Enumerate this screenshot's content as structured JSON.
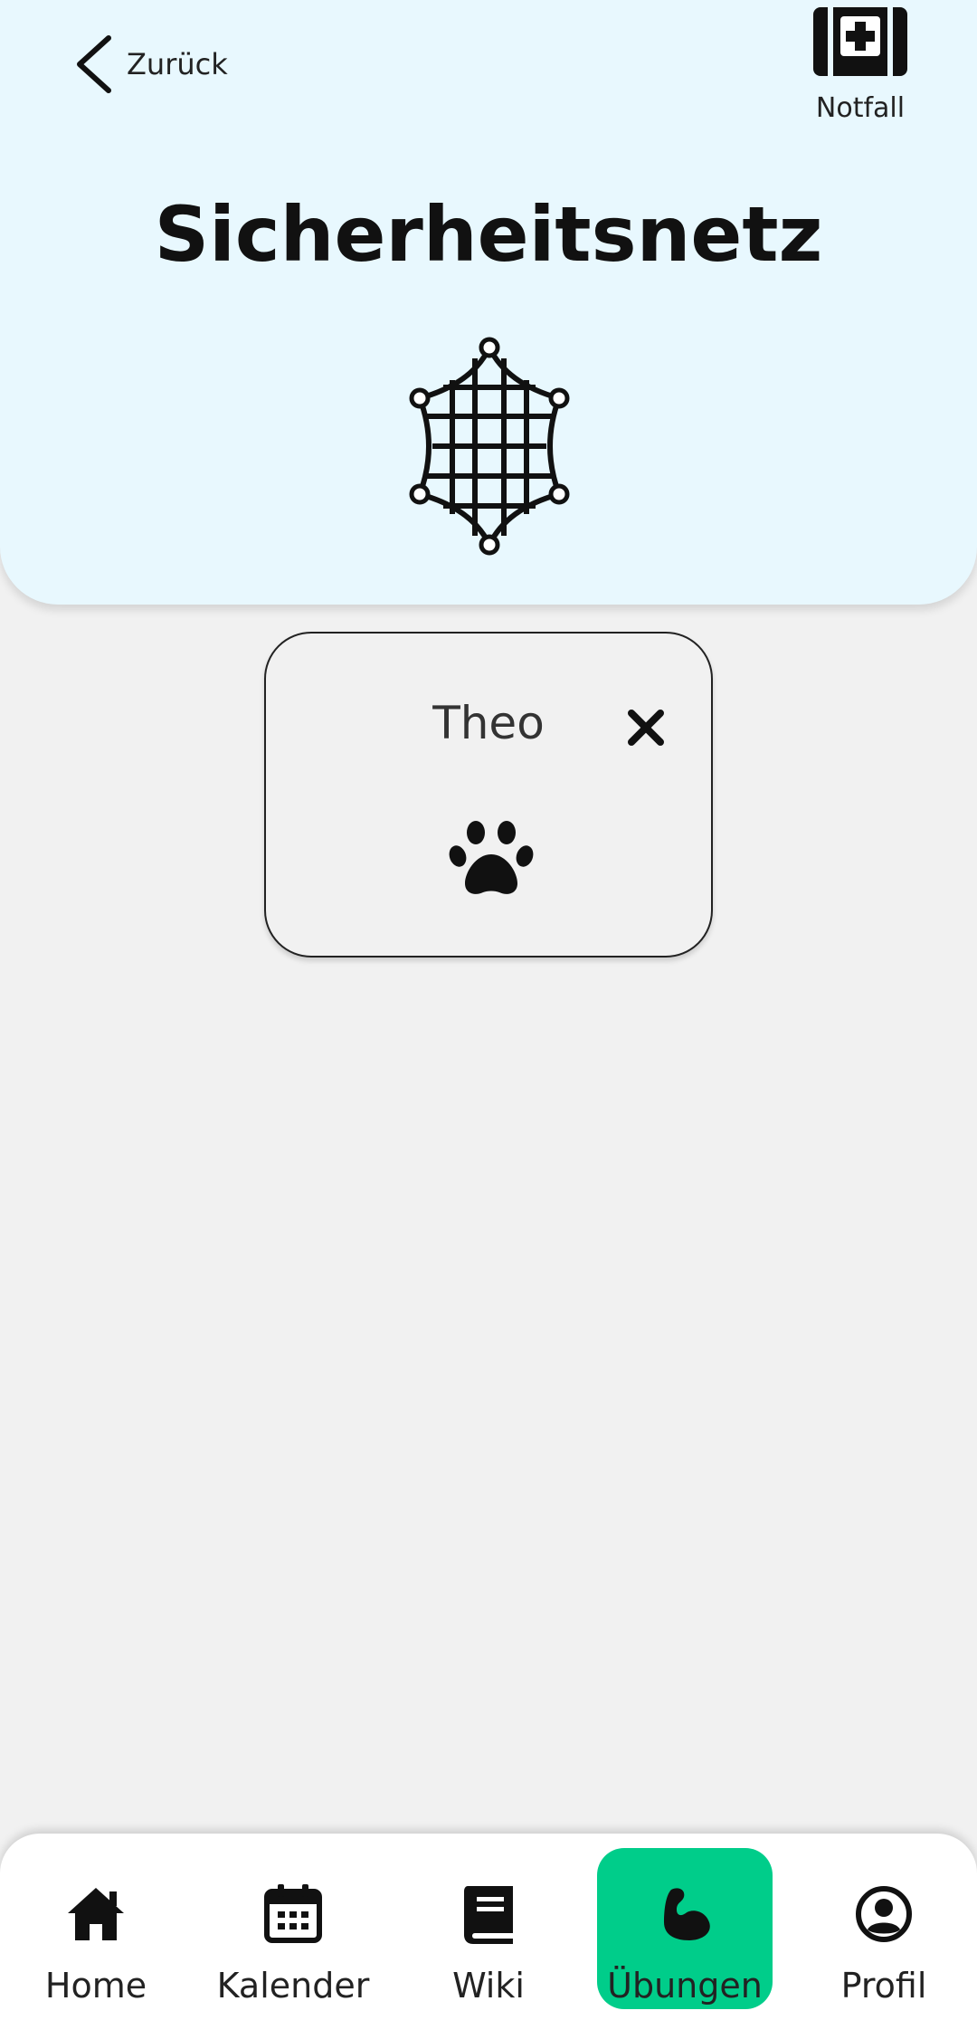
{
  "header": {
    "back_label": "Zurück",
    "emergency_label": "Notfall",
    "title": "Sicherheitsnetz"
  },
  "contact_card": {
    "name": "Theo",
    "icon": "paw-icon"
  },
  "bottom_nav": {
    "items": [
      {
        "label": "Home",
        "icon": "home-icon"
      },
      {
        "label": "Kalender",
        "icon": "calendar-icon"
      },
      {
        "label": "Wiki",
        "icon": "book-icon"
      },
      {
        "label": "Übungen",
        "icon": "muscle-icon",
        "active": true
      },
      {
        "label": "Profil",
        "icon": "profile-icon"
      }
    ],
    "active_color": "#00cd8a"
  },
  "colors": {
    "header_background": "#e8f8fe",
    "page_background": "#f1f1f1"
  }
}
